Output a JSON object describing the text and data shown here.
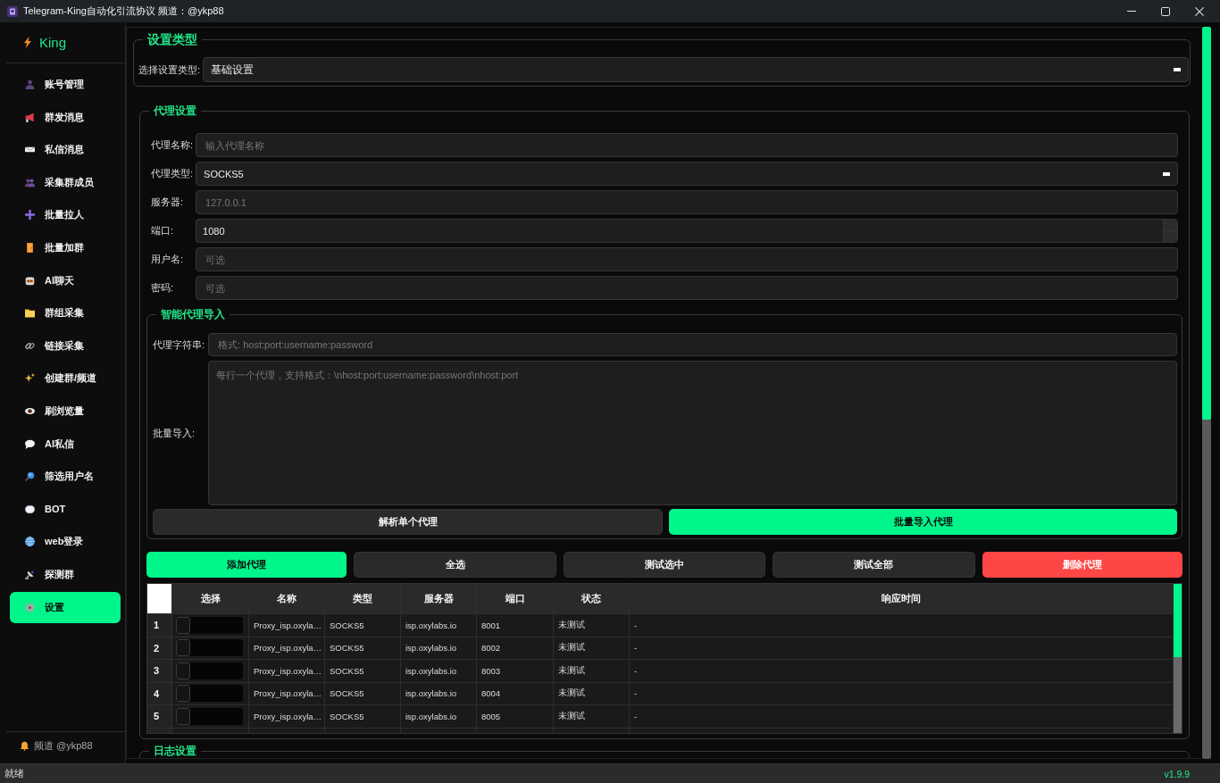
{
  "window": {
    "title": "Telegram-King自动化引流协议 频道：@ykp88"
  },
  "sidebar": {
    "logo": "King",
    "items": [
      {
        "label": "账号管理",
        "selected": false
      },
      {
        "label": "群发消息",
        "selected": false
      },
      {
        "label": "私信消息",
        "selected": false
      },
      {
        "label": "采集群成员",
        "selected": false
      },
      {
        "label": "批量拉人",
        "selected": false
      },
      {
        "label": "批量加群",
        "selected": false
      },
      {
        "label": "AI聊天",
        "selected": false
      },
      {
        "label": "群组采集",
        "selected": false
      },
      {
        "label": "链接采集",
        "selected": false
      },
      {
        "label": "创建群/频道",
        "selected": false
      },
      {
        "label": "刷浏览量",
        "selected": false
      },
      {
        "label": "AI私信",
        "selected": false
      },
      {
        "label": "筛选用户名",
        "selected": false
      },
      {
        "label": "BOT",
        "selected": false
      },
      {
        "label": "web登录",
        "selected": false
      },
      {
        "label": "探测群",
        "selected": false
      },
      {
        "label": "设置",
        "selected": true
      }
    ],
    "footer": "频道 @ykp88"
  },
  "settings_type": {
    "title": "设置类型",
    "label": "选择设置类型:",
    "value": "基础设置"
  },
  "proxy_settings": {
    "title": "代理设置",
    "fields": [
      {
        "label": "代理名称:",
        "kind": "text",
        "placeholder": "输入代理名称"
      },
      {
        "label": "代理类型:",
        "kind": "combo",
        "value": "SOCKS5"
      },
      {
        "label": "服务器:",
        "kind": "text",
        "placeholder": "127.0.0.1"
      },
      {
        "label": "端口:",
        "kind": "spin",
        "value": "1080"
      },
      {
        "label": "用户名:",
        "kind": "text",
        "placeholder": "可选"
      },
      {
        "label": "密码:",
        "kind": "text",
        "placeholder": "可选"
      }
    ],
    "smart_import": {
      "title": "智能代理导入",
      "string_label": "代理字符串:",
      "string_placeholder": "格式: host:port:username:password",
      "batch_label": "批量导入:",
      "batch_placeholder": "每行一个代理，支持格式：\\nhost:port:username:password\\nhost:port",
      "buttons": [
        {
          "label": "解析单个代理",
          "kind": "secondary"
        },
        {
          "label": "批量导入代理",
          "kind": "primary"
        }
      ]
    },
    "actions": [
      {
        "label": "添加代理",
        "kind": "primary"
      },
      {
        "label": "全选",
        "kind": "secondary"
      },
      {
        "label": "测试选中",
        "kind": "secondary"
      },
      {
        "label": "测试全部",
        "kind": "secondary"
      },
      {
        "label": "删除代理",
        "kind": "danger"
      }
    ],
    "proxy_table": {
      "columns": [
        "选择",
        "名称",
        "类型",
        "服务器",
        "端口",
        "状态",
        "响应时间"
      ],
      "rows": [
        {
          "index": "1",
          "checked": false,
          "name": "Proxy_isp.oxyla…",
          "type": "SOCKS5",
          "server": "isp.oxylabs.io",
          "port": "8001",
          "status": "未测试",
          "response_time": "-"
        },
        {
          "index": "2",
          "checked": false,
          "name": "Proxy_isp.oxyla…",
          "type": "SOCKS5",
          "server": "isp.oxylabs.io",
          "port": "8002",
          "status": "未测试",
          "response_time": "-"
        },
        {
          "index": "3",
          "checked": false,
          "name": "Proxy_isp.oxyla…",
          "type": "SOCKS5",
          "server": "isp.oxylabs.io",
          "port": "8003",
          "status": "未测试",
          "response_time": "-"
        },
        {
          "index": "4",
          "checked": false,
          "name": "Proxy_isp.oxyla…",
          "type": "SOCKS5",
          "server": "isp.oxylabs.io",
          "port": "8004",
          "status": "未测试",
          "response_time": "-"
        },
        {
          "index": "5",
          "checked": false,
          "name": "Proxy_isp.oxyla…",
          "type": "SOCKS5",
          "server": "isp.oxylabs.io",
          "port": "8005",
          "status": "未测试",
          "response_time": "-"
        }
      ]
    }
  },
  "log_settings": {
    "title": "日志设置"
  },
  "status_bar": {
    "text": "就绪",
    "version": "v1.9.9"
  }
}
